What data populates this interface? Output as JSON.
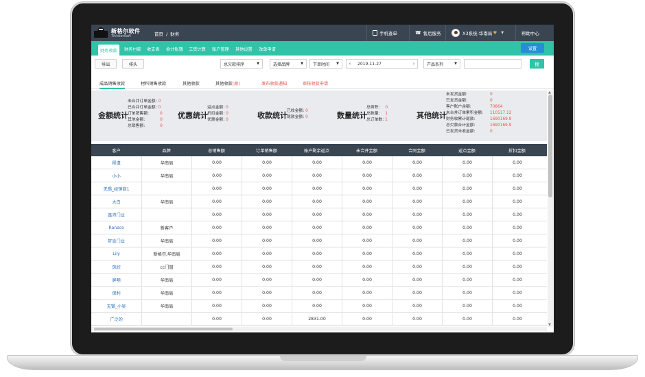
{
  "app": {
    "logo_cn": "新格尔软件",
    "logo_en": "ThinkerSoft"
  },
  "breadcrumb": [
    "首页",
    "财务"
  ],
  "topbar": {
    "mobile_order": "手机查单",
    "after_sales": "售后服务",
    "user_label": "X3系统-华南局",
    "help": "帮助中心"
  },
  "nav": {
    "tabs": [
      "财务收款",
      "财务付款",
      "收支表",
      "会计账簿",
      "工资计算",
      "账户管理",
      "其他设置",
      "改单申请"
    ],
    "active_index": 0,
    "settings_button": "设置"
  },
  "toolbar": {
    "export": "导出",
    "sort": "排头",
    "sort_select": "总欠款排序",
    "brand_select": "选择品牌",
    "time_select": "下单时间",
    "date": "2019-11-27",
    "series_select": "产品系列",
    "search_input": "",
    "search_button": "搜"
  },
  "subtabs": {
    "items": [
      {
        "label": "成品销售收款",
        "active": true
      },
      {
        "label": "材料销售收款",
        "active": false
      },
      {
        "label": "其他收款",
        "active": false
      },
      {
        "label": "其他收款",
        "suffix": "(原)",
        "active": false
      },
      {
        "label": "发布收款通知",
        "red": true
      },
      {
        "label": "审核收款申请",
        "red": true
      }
    ]
  },
  "stats": {
    "amount": {
      "title": "金额统计",
      "rows": [
        {
          "label": "未合并订单金额:",
          "value": "0"
        },
        {
          "label": "已合并订单金额:",
          "value": "0"
        },
        {
          "label": "订单销售额:",
          "value": "0"
        },
        {
          "label": "其他金额:",
          "value": "0"
        },
        {
          "label": "总销售额:",
          "value": "0"
        }
      ]
    },
    "discount": {
      "title": "优惠统计",
      "rows": [
        {
          "label": "返点金额:",
          "value": "0"
        },
        {
          "label": "折扣金额:",
          "value": "0"
        },
        {
          "label": "优惠金额:",
          "value": "0"
        }
      ]
    },
    "collection": {
      "title": "收款统计",
      "rows": [
        {
          "label": "已收金额:",
          "value": "0"
        },
        {
          "label": "尾款金额:",
          "value": "0"
        }
      ]
    },
    "quantity": {
      "title": "数量统计",
      "rows": [
        {
          "label": "总面积:",
          "value": "0"
        },
        {
          "label": "总数量:",
          "value": "1"
        },
        {
          "label": "总订单数:",
          "value": "1"
        }
      ]
    },
    "other": {
      "title": "其他统计",
      "rows": [
        {
          "label": "未发货金额:",
          "value": "0"
        },
        {
          "label": "已发货金额:",
          "value": "0"
        },
        {
          "label": "客户账户余额:",
          "value": "70864"
        },
        {
          "label": "未合并订单累积金额:",
          "value": "110517.12"
        },
        {
          "label": "财务收累计尾款:",
          "value": "1690169.9"
        },
        {
          "label": "总欠款合计金额:",
          "value": "1690169.9"
        },
        {
          "label": "已发货未收金额:",
          "value": "0"
        }
      ]
    }
  },
  "table": {
    "columns": [
      "客户",
      "品牌",
      "总销售额",
      "订单销售额",
      "账户剩余返点",
      "未合并金额",
      "合同金额",
      "返点金额",
      "折扣金额"
    ],
    "rows": [
      [
        "程漢",
        "华南局",
        "0.00",
        "0.00",
        "0.00",
        "0.00",
        "0.00",
        "0.00",
        "0.00"
      ],
      [
        "小小",
        "华南局",
        "0.00",
        "0.00",
        "0.00",
        "0.00",
        "0.00",
        "0.00",
        "0.00"
      ],
      [
        "无锡_经销商1",
        "",
        "0.00",
        "0.00",
        "0.00",
        "0.00",
        "0.00",
        "0.00",
        "0.00"
      ],
      [
        "大白",
        "华南局",
        "0.00",
        "0.00",
        "0.00",
        "0.00",
        "0.00",
        "0.00",
        "0.00"
      ],
      [
        "鑫沛门业",
        "",
        "0.00",
        "0.00",
        "0.00",
        "0.00",
        "0.00",
        "0.00",
        "0.00"
      ],
      [
        "Ransce",
        "新客户",
        "0.00",
        "0.00",
        "0.00",
        "0.00",
        "0.00",
        "0.00",
        "0.00"
      ],
      [
        "轩派门业",
        "华南局",
        "0.00",
        "0.00",
        "0.00",
        "0.00",
        "0.00",
        "0.00",
        "0.00"
      ],
      [
        "Lily",
        "新格尔,华南局",
        "0.00",
        "0.00",
        "0.00",
        "0.00",
        "0.00",
        "0.00",
        "0.00"
      ],
      [
        "凤欣",
        "cc门窗",
        "0.00",
        "0.00",
        "0.00",
        "0.00",
        "0.00",
        "0.00",
        "0.00"
      ],
      [
        "屏明",
        "华南局",
        "0.00",
        "0.00",
        "0.00",
        "0.00",
        "0.00",
        "0.00",
        "0.00"
      ],
      [
        "保利",
        "华南局",
        "0.00",
        "0.00",
        "0.00",
        "0.00",
        "0.00",
        "0.00",
        "0.00"
      ],
      [
        "无锡_小吴",
        "华南局",
        "0.00",
        "0.00",
        "0.00",
        "0.00",
        "0.00",
        "0.00",
        "0.00"
      ],
      [
        "广泛的",
        "",
        "0.00",
        "0.00",
        "2831.00",
        "0.00",
        "0.00",
        "0.00",
        "0.00"
      ]
    ]
  },
  "colors": {
    "topbar": "#3a4552",
    "accent": "#2fc3a8",
    "button_blue": "#2b8cd6",
    "value_red": "#e0574f",
    "link_blue": "#2b6fb8"
  }
}
